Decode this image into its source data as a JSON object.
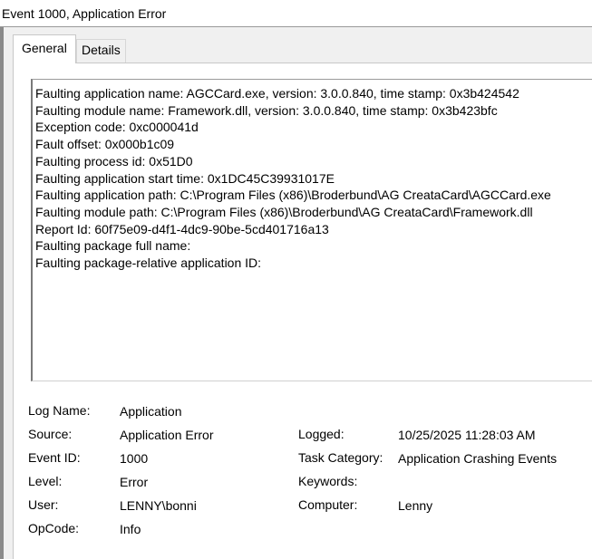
{
  "window": {
    "title": "Event 1000, Application Error"
  },
  "tabs": [
    {
      "label": "General",
      "active": true
    },
    {
      "label": "Details",
      "active": false
    }
  ],
  "message": {
    "lines": [
      "Faulting application name: AGCCard.exe, version: 3.0.0.840, time stamp: 0x3b424542",
      "Faulting module name: Framework.dll, version: 3.0.0.840, time stamp: 0x3b423bfc",
      "Exception code: 0xc000041d",
      "Fault offset: 0x000b1c09",
      "Faulting process id: 0x51D0",
      "Faulting application start time: 0x1DC45C39931017E",
      "Faulting application path: C:\\Program Files (x86)\\Broderbund\\AG CreataCard\\AGCCard.exe",
      "Faulting module path: C:\\Program Files (x86)\\Broderbund\\AG CreataCard\\Framework.dll",
      "Report Id: 60f75e09-d4f1-4dc9-90be-5cd401716a13",
      "Faulting package full name:",
      "Faulting package-relative application ID:"
    ]
  },
  "details": {
    "log_name": {
      "label": "Log Name:",
      "value": "Application"
    },
    "source": {
      "label": "Source:",
      "value": "Application Error"
    },
    "logged": {
      "label": "Logged:",
      "value": "10/25/2025 11:28:03 AM"
    },
    "event_id": {
      "label": "Event ID:",
      "value": "1000"
    },
    "task_category": {
      "label": "Task Category:",
      "value": "Application Crashing Events"
    },
    "level": {
      "label": "Level:",
      "value": "Error"
    },
    "keywords": {
      "label": "Keywords:",
      "value": ""
    },
    "user": {
      "label": "User:",
      "value": "LENNY\\bonni"
    },
    "computer": {
      "label": "Computer:",
      "value": "Lenny"
    },
    "opcode": {
      "label": "OpCode:",
      "value": "Info"
    }
  }
}
